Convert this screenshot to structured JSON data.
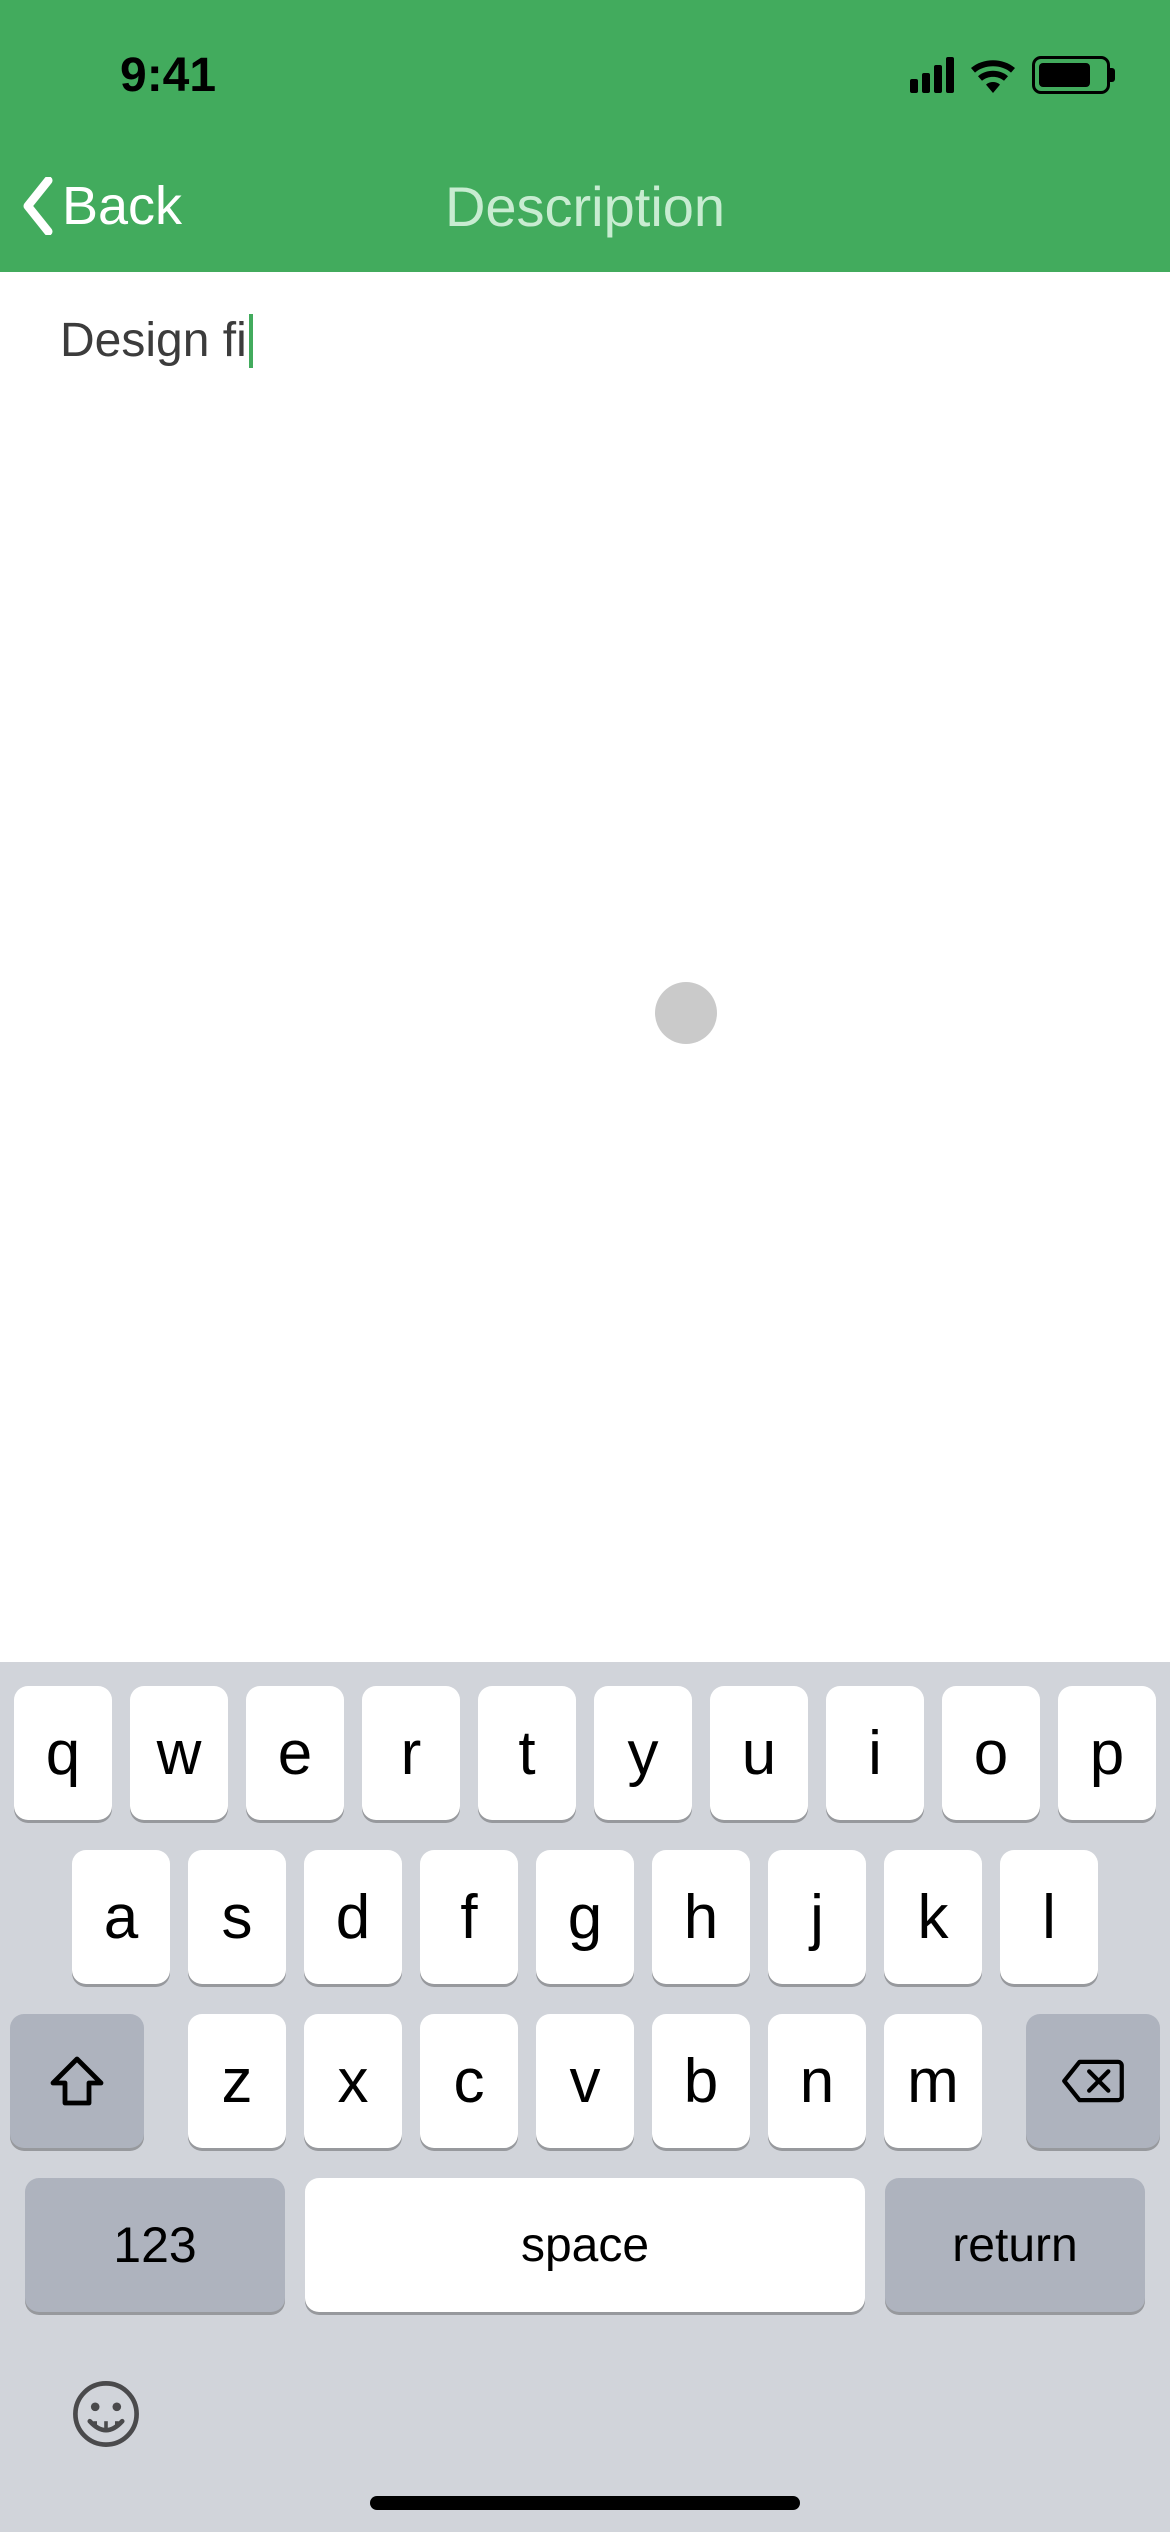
{
  "status": {
    "time": "9:41"
  },
  "nav": {
    "back_label": "Back",
    "title": "Description"
  },
  "editor": {
    "text": "Design fi"
  },
  "keyboard": {
    "row1": [
      "q",
      "w",
      "e",
      "r",
      "t",
      "y",
      "u",
      "i",
      "o",
      "p"
    ],
    "row2": [
      "a",
      "s",
      "d",
      "f",
      "g",
      "h",
      "j",
      "k",
      "l"
    ],
    "row3": [
      "z",
      "x",
      "c",
      "v",
      "b",
      "n",
      "m"
    ],
    "mode_label": "123",
    "space_label": "space",
    "return_label": "return"
  }
}
